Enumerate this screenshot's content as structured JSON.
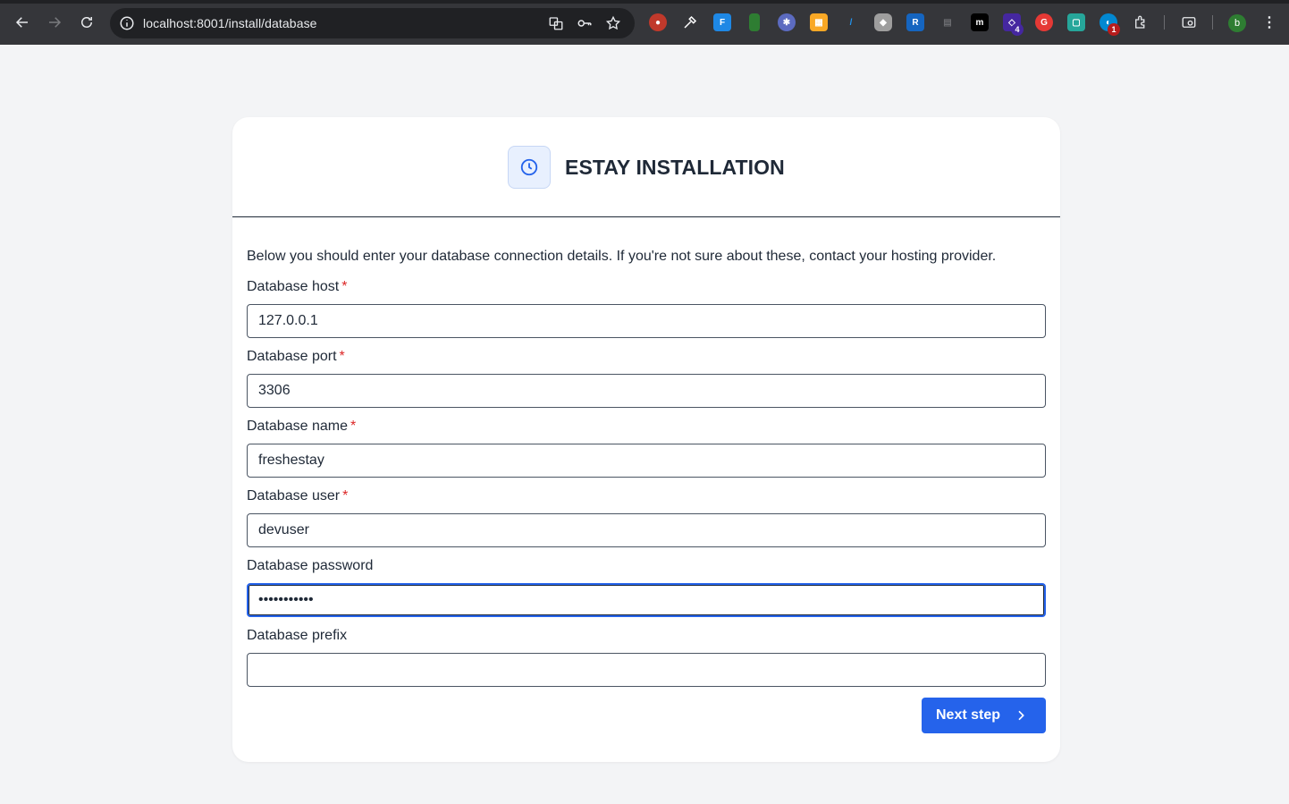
{
  "browser": {
    "url": "localhost:8001/install/database",
    "extension_badges": {
      "first": "4",
      "second": "1"
    },
    "profile_initial": "b"
  },
  "header": {
    "title": "ESTAY INSTALLATION"
  },
  "form": {
    "intro": "Below you should enter your database connection details. If you're not sure about these, contact your hosting provider.",
    "required_marker": "*",
    "fields": [
      {
        "label": "Database host",
        "value": "127.0.0.1",
        "required": true
      },
      {
        "label": "Database port",
        "value": "3306",
        "required": true
      },
      {
        "label": "Database name",
        "value": "freshestay",
        "required": true
      },
      {
        "label": "Database user",
        "value": "devuser",
        "required": true
      },
      {
        "label": "Database password",
        "value": "•••••••••••",
        "required": false
      },
      {
        "label": "Database prefix",
        "value": "",
        "required": false
      }
    ],
    "submit_label": "Next step"
  },
  "colors": {
    "accent": "#2563eb",
    "required": "#dc2626",
    "page_bg": "#f3f4f6"
  }
}
